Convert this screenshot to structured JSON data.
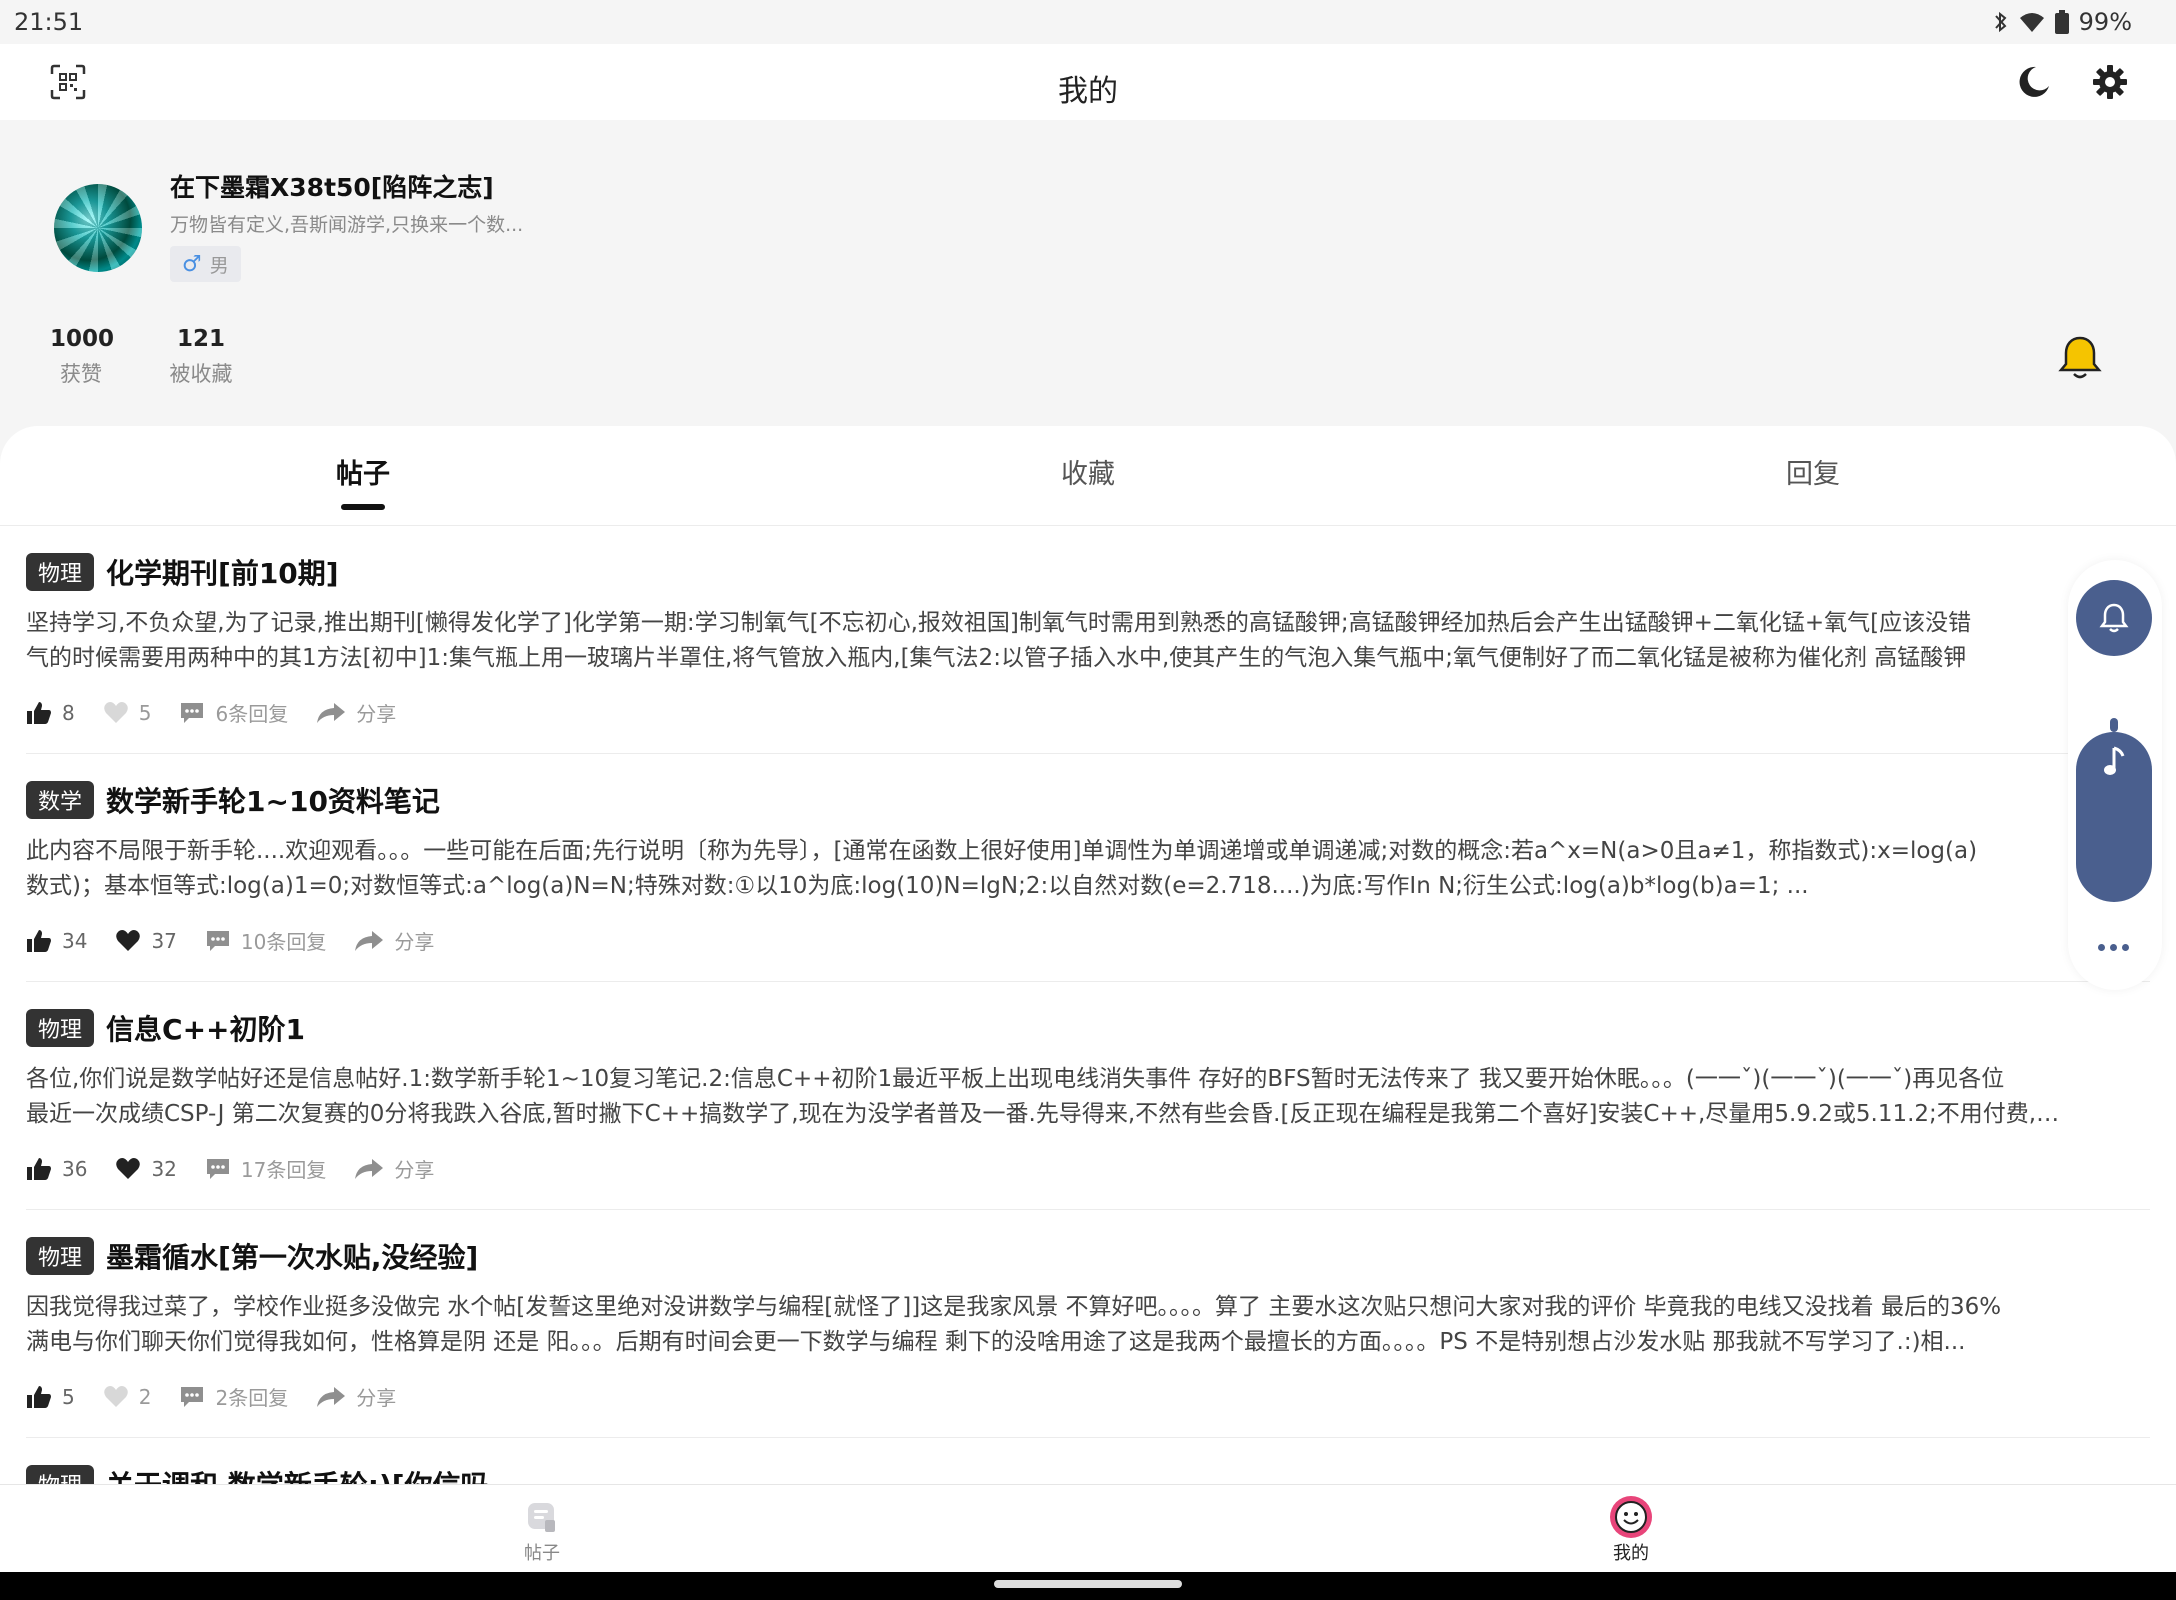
{
  "status_bar": {
    "time": "21:51",
    "battery": "99%"
  },
  "app_bar": {
    "title": "我的"
  },
  "profile": {
    "username": "在下墨霜X38t50[陷阵之志]",
    "bio": "万物皆有定义,吾斯闻游学,只换来一个数...",
    "gender_symbol": "♂",
    "gender": "男",
    "stats": [
      {
        "value": "1000",
        "label": "获赞"
      },
      {
        "value": "121",
        "label": "被收藏"
      }
    ]
  },
  "tabs": [
    {
      "label": "帖子",
      "active": true
    },
    {
      "label": "收藏",
      "active": false
    },
    {
      "label": "回复",
      "active": false
    }
  ],
  "posts": [
    {
      "category": "物理",
      "title": "化学期刊[前10期]",
      "body_lines": [
        "坚持学习,不负众望,为了记录,推出期刊[懒得发化学了]化学第一期:学习制氧气[不忘初心,报效祖国]制氧气时需用到熟悉的高锰酸钾;高锰酸钾经加热后会产生出锰酸钾+二氧化锰+氧气[应该没错",
        "气的时候需要用两种中的其1方法[初中]1:集气瓶上用一玻璃片半罩住,将气管放入瓶内,[集气法2:以管子插入水中,使其产生的气泡入集气瓶中;氧气便制好了而二氧化锰是被称为催化剂   高锰酸钾"
      ],
      "likes": "8",
      "hearts": "5",
      "replies": "6条回复",
      "share": "分享",
      "hearts_filled": false,
      "replies_muted": true
    },
    {
      "category": "数学",
      "title": "数学新手轮1~10资料笔记",
      "body_lines": [
        "此内容不局限于新手轮....欢迎观看。。。一些可能在后面;先行说明〔称为先导〕，[通常在函数上很好使用]单调性为单调递增或单调递减;对数的概念:若a^x=N(a>0且a≠1，称指数式):x=log(a)",
        "数式)；基本恒等式:log(a)1=0;对数恒等式:a^log(a)N=N;特殊对数:①以10为底:log(10)N=lgN;2:以自然对数(e=2.718....)为底:写作In N;衍生公式:log(a)b*log(b)a=1; ..."
      ],
      "likes": "34",
      "hearts": "37",
      "replies": "10条回复",
      "share": "分享",
      "hearts_filled": true,
      "replies_muted": true
    },
    {
      "category": "物理",
      "title": "信息C++初阶1",
      "body_lines": [
        "各位,你们说是数学帖好还是信息帖好.1:数学新手轮1~10复习笔记.2:信息C++初阶1最近平板上出现电线消失事件 存好的BFS暂时无法传来了 我又要开始休眠。。。(一一ˇ)(一一ˇ)(一一ˇ)再见各位",
        "最近一次成绩CSP-J 第二次复赛的0分将我跌入谷底,暂时撇下C++搞数学了,现在为没学者普及一番.先导得来,不然有些会昏.[反正现在编程是我第二个喜好]安装C++,尽量用5.9.2或5.11.2;不用付费,但..."
      ],
      "likes": "36",
      "hearts": "32",
      "replies": "17条回复",
      "share": "分享",
      "hearts_filled": true,
      "replies_muted": true
    },
    {
      "category": "物理",
      "title": "墨霜循水[第一次水贴,没经验]",
      "body_lines": [
        "因我觉得我过菜了，学校作业挺多没做完 水个帖[发誓这里绝对没讲数学与编程[就怪了]]这是我家风景 不算好吧。。。。算了 主要水这次贴只想问大家对我的评价 毕竟我的电线又没找着 最后的36%",
        "满电与你们聊天你们觉得我如何，性格算是阴 还是 阳。。。后期有时间会更一下数学与编程 剩下的没啥用途了这是我两个最擅长的方面。。。。PS 不是特别想占沙发水贴 那我就不写学习了.:)相..."
      ],
      "likes": "5",
      "hearts": "2",
      "replies": "2条回复",
      "share": "分享",
      "hearts_filled": false,
      "replies_muted": true
    },
    {
      "category": "物理",
      "title": "关于调和 数学新手轮:)[你信吗",
      "body_lines": [],
      "likes": "",
      "hearts": "",
      "replies": "",
      "share": "",
      "hearts_filled": false,
      "replies_muted": true
    }
  ],
  "bottom_nav": [
    {
      "label": "帖子",
      "active": false
    },
    {
      "label": "我的",
      "active": true
    }
  ],
  "colors": {
    "accent_blue": "#4a5f8e",
    "bell_yellow": "#f5c400",
    "avatar_pink": "#e8457a"
  }
}
